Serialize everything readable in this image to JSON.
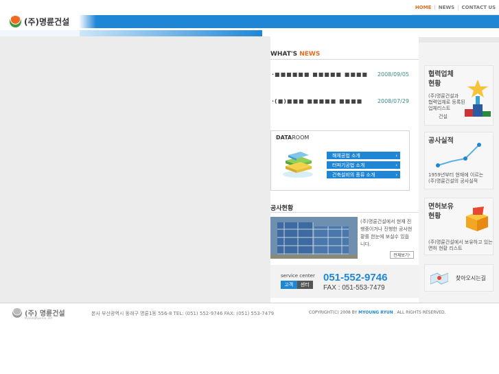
{
  "nav": {
    "home": "HOME",
    "news": "NEWS",
    "contact": "CONTACT US"
  },
  "logo": {
    "text": "(주)명륜건설"
  },
  "news": {
    "title_prefix": "WHAT'S",
    "title_highlight": "NEWS",
    "items": [
      {
        "title": "·■■■■■■ ■■■■■ ■■■■",
        "date": "2008/09/05"
      },
      {
        "title": "·(■)■■■ ■■■■■ ■■■■",
        "date": "2008/07/29"
      }
    ]
  },
  "dataroom": {
    "title_bold": "DATA",
    "title_rest": "ROOM",
    "buttons": [
      "해체공법 소개",
      "터파기공법 소개",
      "건축설비의 종류 소개"
    ]
  },
  "construction": {
    "title": "공사현황",
    "desc": "(주)명륜건설에서 현재 진행중이거나 진행한 공사현황를 한눈에 보실수 있읍니다.",
    "more": "전체보기"
  },
  "service": {
    "en": "service center",
    "ko1": "고객",
    "ko2": "센터",
    "phone": "051-552-9746",
    "fax": "FAX : 051-553-7479"
  },
  "right": {
    "partner": {
      "title1": "협력업체",
      "title2": "현황",
      "desc1": "(주)명륜건설과",
      "desc2": "협력업체로 등록된",
      "desc3": "업체리스트",
      "desc4": "건설"
    },
    "record": {
      "title": "공사실적",
      "desc1": "1959년부터 현재에 이르는",
      "desc2": "(주)명륜건설의 공사실적"
    },
    "license": {
      "title1": "면허보유",
      "title2": "현황",
      "desc1": "(주)명륜건설에서 보유하고 있는",
      "desc2": "면허 현황 리스트"
    },
    "map": "찾아오시는길"
  },
  "footer": {
    "logo": "(주) 명륜건설",
    "logo_sub": "MyoungRyunCo.,Ltd",
    "address": "본사 부산광역시 동래구 명륜1동 556-8    TEL: (051) 552-9746  FAX: (051) 553-7479",
    "copy_prefix": "COPYRIGHT(C) 2008 BY",
    "copy_brand": "MYOUNG RYUN",
    "copy_suffix": ". ALL RIGHTS RESERVED."
  },
  "colors": {
    "accent": "#1f86d6",
    "orange": "#e86a1e"
  }
}
